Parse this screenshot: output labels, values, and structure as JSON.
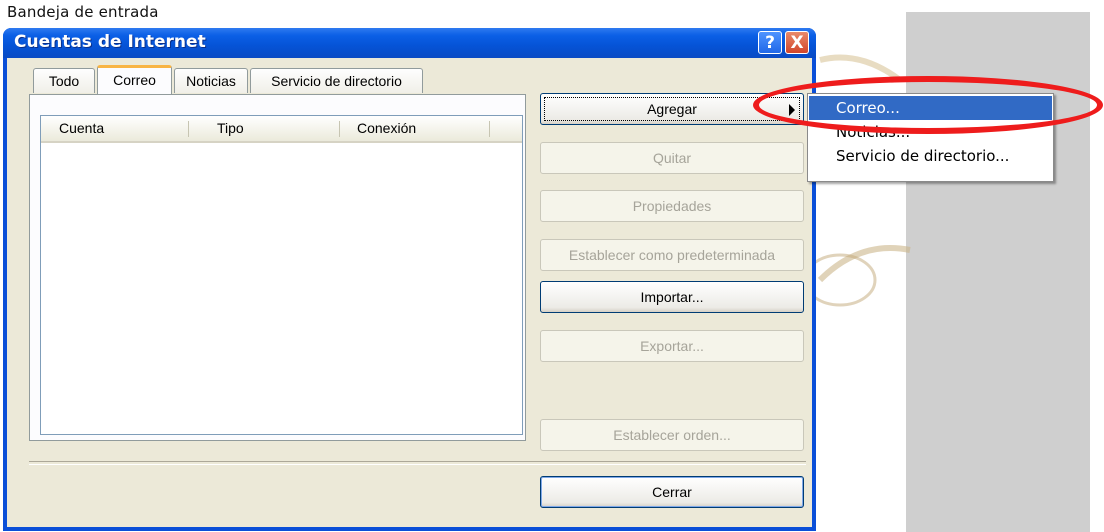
{
  "background": {
    "folder_label": "Bandeja de entrada"
  },
  "window": {
    "title": "Cuentas de Internet",
    "help_label": "?",
    "close_label": "X"
  },
  "tabs": [
    {
      "label": "Todo"
    },
    {
      "label": "Correo"
    },
    {
      "label": "Noticias"
    },
    {
      "label": "Servicio de directorio"
    }
  ],
  "active_tab": "Correo",
  "list": {
    "columns": [
      "Cuenta",
      "Tipo",
      "Conexión"
    ],
    "rows": []
  },
  "buttons": {
    "agregar": "Agregar",
    "quitar": "Quitar",
    "propiedades": "Propiedades",
    "establecer_predeterminada": "Establecer como predeterminada",
    "importar": "Importar...",
    "exportar": "Exportar...",
    "establecer_orden": "Establecer orden...",
    "cerrar": "Cerrar"
  },
  "menu": {
    "items": [
      {
        "label": "Correo..."
      },
      {
        "label": "Noticias..."
      },
      {
        "label": "Servicio de directorio..."
      }
    ],
    "selected": "Correo..."
  },
  "colors": {
    "titlebar": "#0553d6",
    "menu_highlight": "#316ac5",
    "annotation_ellipse": "#ee1c1c"
  }
}
